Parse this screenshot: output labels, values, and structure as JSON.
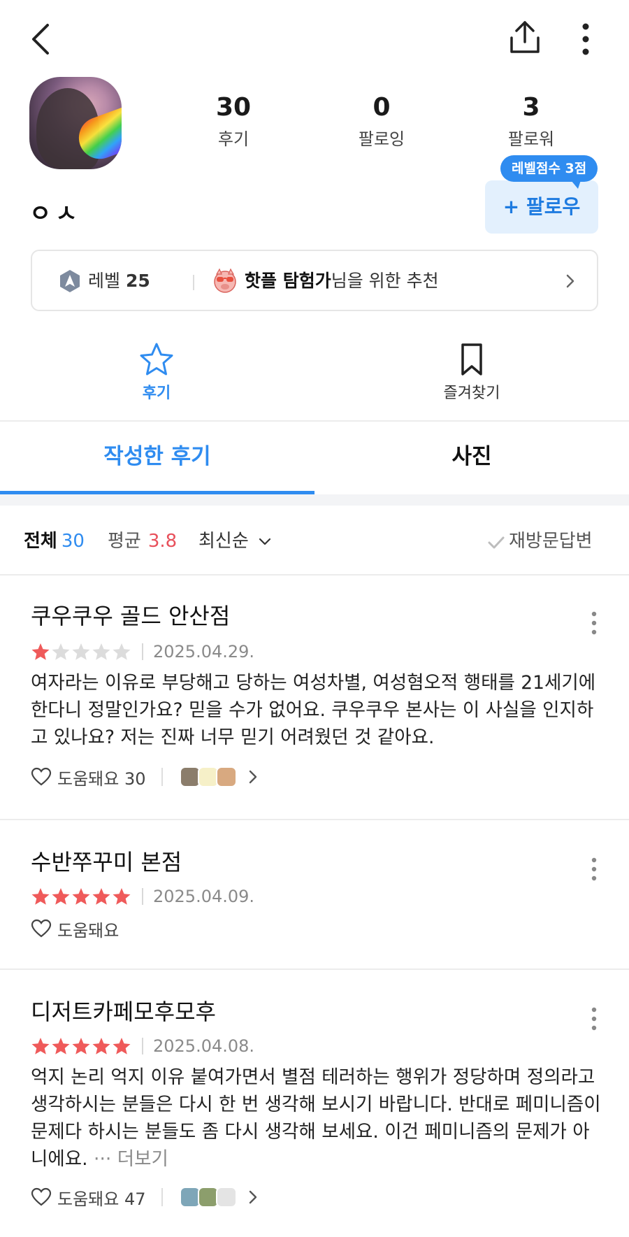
{
  "header": {
    "back_icon": "chevron-left-icon",
    "share_icon": "share-upload-icon",
    "more_icon": "more-vertical-icon"
  },
  "profile": {
    "nickname": "ㅇㅅ",
    "stats": [
      {
        "value": "30",
        "label": "후기"
      },
      {
        "value": "0",
        "label": "팔로잉"
      },
      {
        "value": "3",
        "label": "팔로워"
      }
    ],
    "level_bubble": "레벨점수 3점",
    "follow_label": "+ 팔로우"
  },
  "recommendation": {
    "level_prefix": "레벨",
    "level_value": "25",
    "explorer_name": "핫플 탐험가",
    "suffix": "님을 위한 추천"
  },
  "type_tabs": [
    {
      "label": "후기",
      "icon": "star-icon",
      "active": true
    },
    {
      "label": "즐겨찾기",
      "icon": "bookmark-icon",
      "active": false
    }
  ],
  "sub_tabs": [
    {
      "label": "작성한 후기",
      "active": true
    },
    {
      "label": "사진",
      "active": false
    }
  ],
  "filter": {
    "all_label": "전체",
    "all_count": "30",
    "avg_label": "평균",
    "avg_value": "3.8",
    "sort_label": "최신순",
    "revisit_label": "재방문답변"
  },
  "reviews": [
    {
      "place": "쿠우쿠우 골드 안산점",
      "rating": 1,
      "date": "2025.04.29.",
      "body": "여자라는 이유로 부당해고 당하는 여성차별, 여성혐오적 행태를 21세기에 한다니 정말인가요? 믿을 수가 없어요. 쿠우쿠우 본사는 이 사실을 인지하고 있나요? 저는 진짜 너무 믿기 어려웠던 것 같아요.",
      "more": "",
      "helpful_label": "도움돼요 30",
      "has_reactors": true
    },
    {
      "place": "수반쭈꾸미 본점",
      "rating": 5,
      "date": "2025.04.09.",
      "body": "",
      "more": "",
      "helpful_label": "도움돼요",
      "has_reactors": false
    },
    {
      "place": "디저트카페모후모후",
      "rating": 5,
      "date": "2025.04.08.",
      "body": "억지 논리 억지 이유 붙여가면서 별점 테러하는 행위가 정당하며 정의라고 생각하시는 분들은 다시 한 번 생각해 보시기 바랍니다. 반대로 페미니즘이 문제다 하시는 분들도 좀 다시 생각해 보세요. 이건 페미니즘의 문제가 아니에요.",
      "more": "··· 더보기",
      "helpful_label": "도움돼요 47",
      "has_reactors": true
    }
  ],
  "colors": {
    "accent": "#2f8cf0",
    "star_on": "#ef5a5a",
    "star_off": "#dcdcdc",
    "avg_value": "#e8505b"
  }
}
